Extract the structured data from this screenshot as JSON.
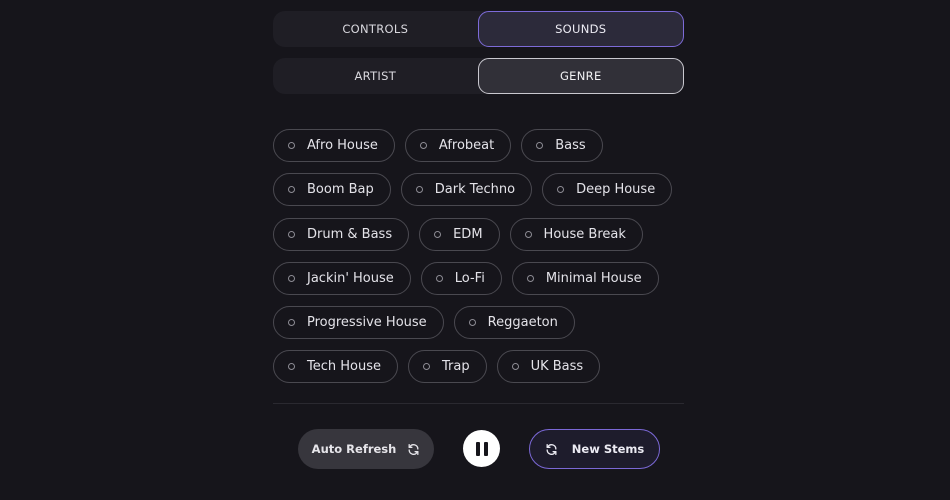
{
  "tabs_primary": [
    {
      "label": "CONTROLS",
      "active": false
    },
    {
      "label": "SOUNDS",
      "active": true
    }
  ],
  "tabs_secondary": [
    {
      "label": "ARTIST",
      "active": false
    },
    {
      "label": "GENRE",
      "active": true
    }
  ],
  "genres": {
    "rows": [
      [
        "Afro House",
        "Afrobeat",
        "Bass"
      ],
      [
        "Boom Bap",
        "Dark Techno",
        "Deep House"
      ],
      [
        "Drum & Bass",
        "EDM",
        "House Break"
      ],
      [
        "Jackin' House",
        "Lo-Fi",
        "Minimal House"
      ],
      [
        "Progressive House",
        "Reggaeton"
      ],
      [
        "Tech House",
        "Trap",
        "UK Bass"
      ]
    ]
  },
  "controls": {
    "auto_refresh_label": "Auto Refresh",
    "auto_refresh_icon": "refresh-icon",
    "pause_icon": "pause-icon",
    "new_stems_label": "New Stems",
    "new_stems_icon": "refresh-icon"
  },
  "colors": {
    "background": "#16151b",
    "accent_purple": "#7d6bd9",
    "chip_border": "#4a4950"
  }
}
